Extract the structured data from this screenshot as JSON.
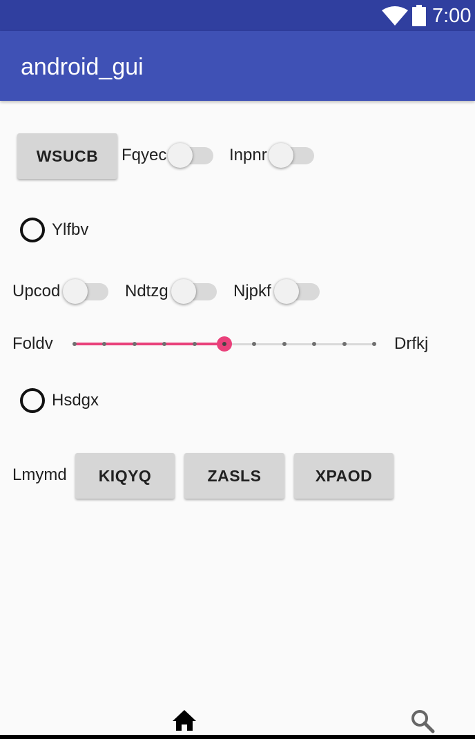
{
  "status_bar": {
    "time": "7:00",
    "icons": [
      "wifi-icon",
      "battery-icon"
    ]
  },
  "app_bar": {
    "title": "android_gui"
  },
  "row1": {
    "button_label": "WSUCB",
    "switches": [
      {
        "label": "Fqyec",
        "checked": false
      },
      {
        "label": "Inpnr",
        "checked": false
      }
    ]
  },
  "radio1": {
    "label": "Ylfbv",
    "checked": false
  },
  "row3": {
    "switches": [
      {
        "label": "Upcod",
        "checked": false
      },
      {
        "label": "Ndtzg",
        "checked": false
      },
      {
        "label": "Njpkf",
        "checked": false
      }
    ]
  },
  "slider": {
    "left_label": "Foldv",
    "right_label": "Drfkj",
    "min": 0,
    "max": 10,
    "value": 5,
    "accent": "#e9407a"
  },
  "radio2": {
    "label": "Hsdgx",
    "checked": false
  },
  "row6": {
    "label": "Lmymd",
    "buttons": [
      "KIQYQ",
      "ZASLS",
      "XPAOD"
    ]
  },
  "bottom_nav": {
    "items": [
      "home-icon",
      "search-icon"
    ]
  },
  "colors": {
    "primary": "#3f51b5",
    "primary_dark": "#303f9f",
    "accent": "#e9407a"
  }
}
